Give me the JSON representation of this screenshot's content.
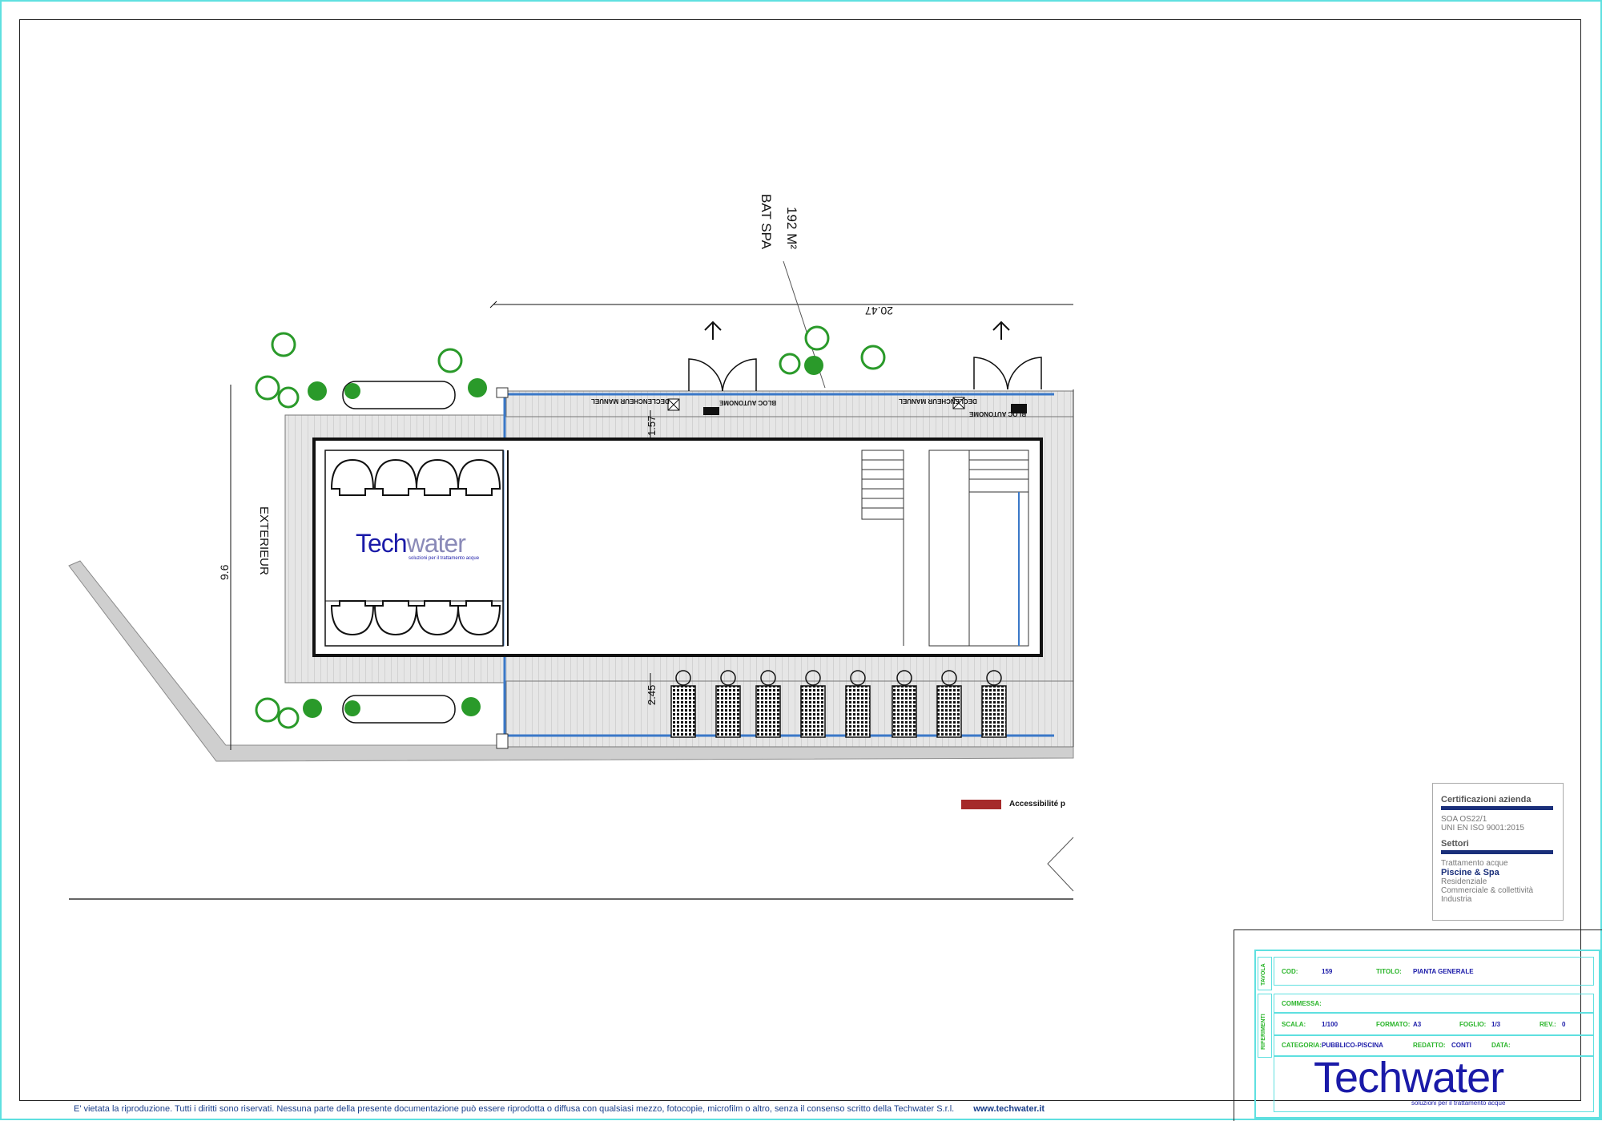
{
  "plan": {
    "area_label": "192 M²",
    "building_label": "BAT SPA",
    "dim_width": "20.47",
    "dim_height": "9.6",
    "dim_top_strip": "1.57",
    "dim_bottom_strip": "2.45",
    "exterior_label": "EXTERIEUR",
    "block_label_1": "BLOC AUTONOME",
    "block_label_2": "DECLENCHEUR MANUEL",
    "legend_label": "Accessibilité p"
  },
  "center_logo": {
    "tech": "Tech",
    "water": "water",
    "tagline": "soluzioni per il trattamento acque"
  },
  "certifications": {
    "heading": "Certificazioni azienda",
    "items": [
      "SOA OS22/1",
      "UNI EN ISO 9001:2015"
    ],
    "sectors_heading": "Settori",
    "sectors": [
      "Trattamento acque",
      "Piscine & Spa",
      "Residenziale",
      "Commerciale & collettività",
      "Industria"
    ],
    "highlighted_sector": "Piscine & Spa"
  },
  "title_block": {
    "side_tavola": "TAVOLA",
    "side_riferimenti": "RIFERIMENTI",
    "cod_label": "COD:",
    "cod_value": "159",
    "titolo_label": "TITOLO:",
    "titolo_value": "PIANTA GENERALE",
    "commessa_label": "COMMESSA:",
    "scala_label": "SCALA:",
    "scala_value": "1/100",
    "formato_label": "FORMATO:",
    "formato_value": "A3",
    "foglio_label": "FOGLIO:",
    "foglio_value": "1/3",
    "rev_label": "REV.:",
    "rev_value": "0",
    "categoria_label": "CATEGORIA:",
    "categoria_value": "PUBBLICO-PISCINA",
    "redatto_label": "REDATTO:",
    "redatto_value": "CONTI",
    "data_label": "DATA:",
    "logo_tech": "Tech",
    "logo_water": "water",
    "logo_tagline": "soluzioni per il trattamento acque"
  },
  "footer": {
    "disclaimer": "E' vietata la riproduzione. Tutti i diritti sono riservati. Nessuna parte della presente documentazione può essere riprodotta o diffusa con qualsiasi mezzo, fotocopie, microfilm o altro, senza il consenso scritto della Techwater S.r.l.",
    "url": "www.techwater.it"
  },
  "colors": {
    "frame_cyan": "#5fe0e0",
    "brand_blue": "#1a1aa8",
    "label_green": "#2ab52a",
    "legend_red": "#a52a2a",
    "water_blue": "#3a78c8",
    "tree_green": "#2a9a2a"
  }
}
